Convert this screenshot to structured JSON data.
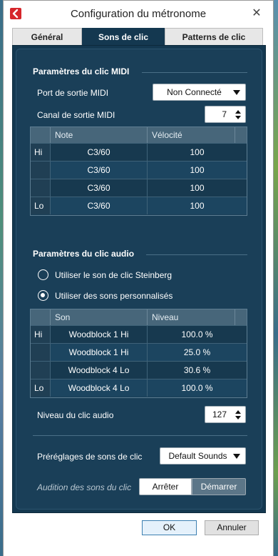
{
  "window": {
    "title": "Configuration du métronome"
  },
  "tabs": [
    {
      "label": "Général"
    },
    {
      "label": "Sons de clic"
    },
    {
      "label": "Patterns de clic"
    }
  ],
  "midi": {
    "section_title": "Paramètres du clic MIDI",
    "port_label": "Port de sortie MIDI",
    "port_value": "Non Connecté",
    "channel_label": "Canal de sortie MIDI",
    "channel_value": "7",
    "table": {
      "columns": [
        "Note",
        "Vélocité"
      ],
      "rows": [
        {
          "side": "Hi",
          "note": "C3/60",
          "velocity": "100"
        },
        {
          "side": "",
          "note": "C3/60",
          "velocity": "100"
        },
        {
          "side": "",
          "note": "C3/60",
          "velocity": "100"
        },
        {
          "side": "Lo",
          "note": "C3/60",
          "velocity": "100"
        }
      ]
    }
  },
  "audio": {
    "section_title": "Paramètres du clic audio",
    "option_steinberg": "Utiliser le son de clic Steinberg",
    "option_custom": "Utiliser des sons personnalisés",
    "selected_option": "custom",
    "table": {
      "columns": [
        "Son",
        "Niveau"
      ],
      "rows": [
        {
          "side": "Hi",
          "sound": "Woodblock 1 Hi",
          "level": "100.0 %"
        },
        {
          "side": "",
          "sound": "Woodblock 1 Hi",
          "level": "25.0 %"
        },
        {
          "side": "",
          "sound": "Woodblock 4 Lo",
          "level": "30.6 %"
        },
        {
          "side": "Lo",
          "sound": "Woodblock 4 Lo",
          "level": "100.0 %"
        }
      ]
    },
    "level_label": "Niveau du clic audio",
    "level_value": "127"
  },
  "presets": {
    "label": "Préréglages de sons de clic",
    "value": "Default Sounds"
  },
  "audition": {
    "label": "Audition des sons du clic",
    "stop_label": "Arrêter",
    "start_label": "Démarrer"
  },
  "footer": {
    "ok_label": "OK",
    "cancel_label": "Annuler"
  },
  "colors": {
    "panel_bg": "#143850",
    "active_tab": "#143850",
    "app_icon": "#d6262b"
  }
}
